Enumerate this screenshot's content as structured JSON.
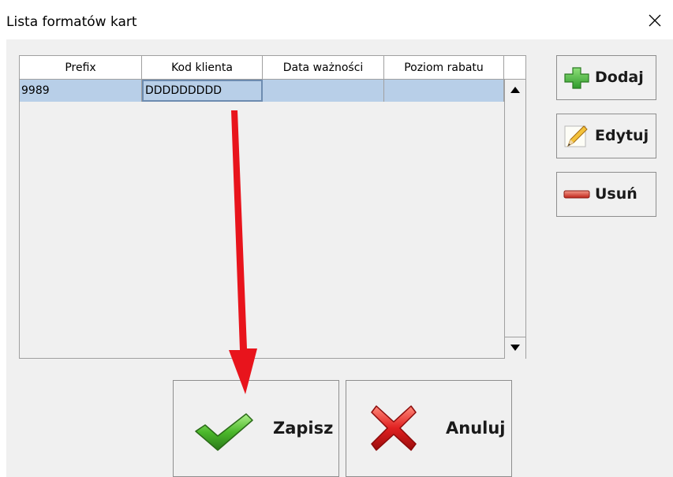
{
  "window": {
    "title": "Lista formatów kart"
  },
  "grid": {
    "columns": [
      "Prefix",
      "Kod klienta",
      "Data ważności",
      "Poziom rabatu"
    ],
    "rows": [
      {
        "prefix": "9989",
        "kod_klienta": "DDDDDDDDD",
        "data_waznosci": "",
        "poziom_rabatu": ""
      }
    ]
  },
  "side_buttons": {
    "add": "Dodaj",
    "edit": "Edytuj",
    "delete": "Usuń"
  },
  "footer_buttons": {
    "save": "Zapisz",
    "cancel": "Anuluj"
  },
  "colors": {
    "selection": "#b8cfe8",
    "annotation_arrow": "#e8141c",
    "add_icon": "#3cb043",
    "delete_icon": "#d9372b",
    "save_icon": "#4cb82b",
    "cancel_icon": "#e02020"
  },
  "icons": {
    "close": "close-icon",
    "add": "plus-icon",
    "edit": "pencil-icon",
    "delete": "minus-icon",
    "save": "checkmark-icon",
    "cancel": "x-mark-icon",
    "scroll_up": "triangle-up-icon",
    "scroll_down": "triangle-down-icon"
  }
}
